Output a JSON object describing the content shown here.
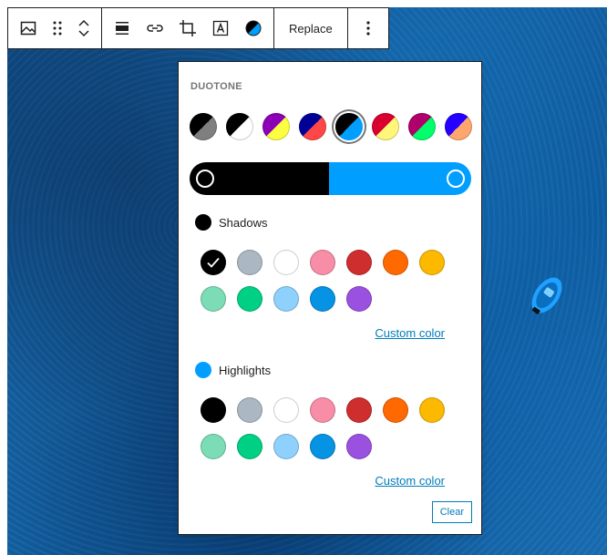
{
  "toolbar": {
    "replace_label": "Replace"
  },
  "duotone": {
    "title": "DUOTONE",
    "presets": [
      {
        "a": "#000000",
        "b": "#7f7f7f"
      },
      {
        "a": "#000000",
        "b": "#ffffff"
      },
      {
        "a": "#8c00b7",
        "b": "#fcff41"
      },
      {
        "a": "#000097",
        "b": "#ff4747"
      },
      {
        "a": "#000000",
        "b": "#009eff"
      },
      {
        "a": "#d9002f",
        "b": "#fff67a"
      },
      {
        "a": "#b0006b",
        "b": "#00ff6a"
      },
      {
        "a": "#2300ff",
        "b": "#ffa66f"
      }
    ],
    "selected_preset": 4,
    "shadow_color": "#000000",
    "highlight_color": "#009eff"
  },
  "shadows": {
    "label": "Shadows",
    "custom_color_label": "Custom color"
  },
  "highlights": {
    "label": "Highlights",
    "custom_color_label": "Custom color"
  },
  "palette": [
    "#000000",
    "#abb8c3",
    "#ffffff",
    "#f78da7",
    "#cf2e2e",
    "#ff6900",
    "#fcb900",
    "#7bdcb5",
    "#00d084",
    "#8ed1fc",
    "#0693e3",
    "#9b51e0"
  ],
  "shadows_selected_index": 0,
  "clear_label": "Clear"
}
